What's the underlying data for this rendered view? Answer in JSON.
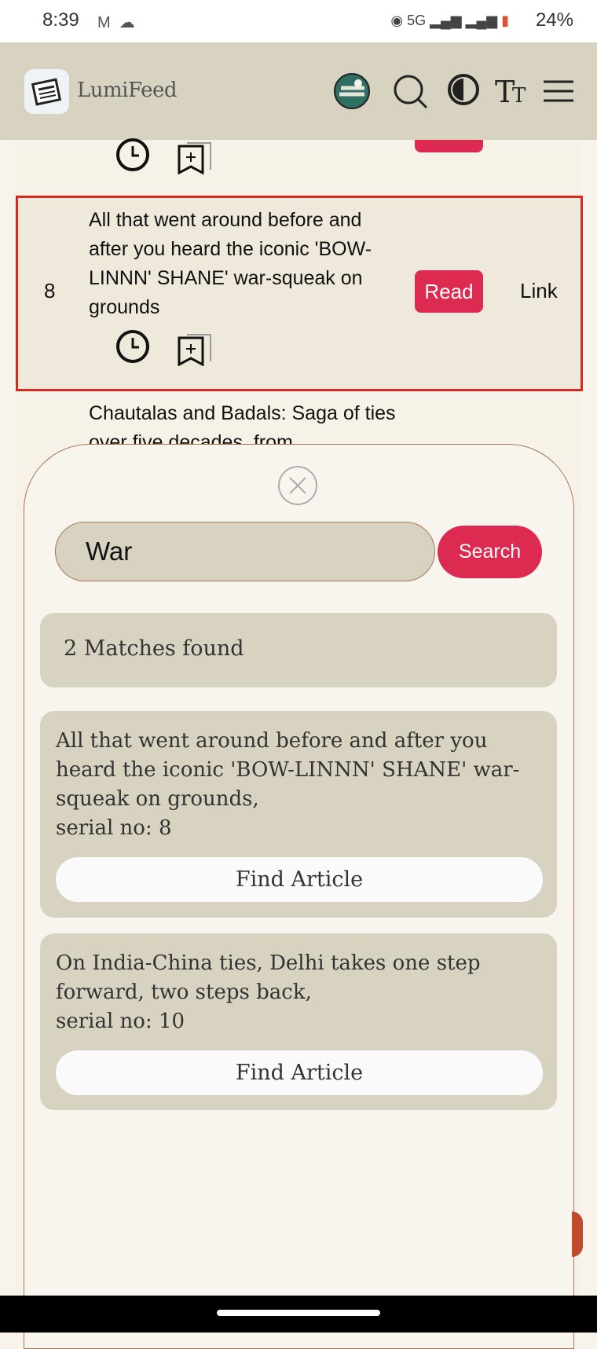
{
  "status_bar": {
    "time": "8:39",
    "network": "5G",
    "battery": "24%"
  },
  "app": {
    "name": "LumiFeed"
  },
  "list": {
    "highlighted_row": {
      "number": "8",
      "title": "All that went around before and after you heard the iconic 'BOW-LINNN' SHANE' war-squeak on grounds",
      "read_label": "Read",
      "link_label": "Link"
    },
    "next_row_title": "Chautalas and Badals: Saga of ties over five decades, from"
  },
  "search": {
    "query": "War",
    "button_label": "Search",
    "matches_text": "2 Matches found",
    "results": [
      {
        "title": "All that went around before and after you heard the iconic 'BOW-LINNN' SHANE' war-squeak on grounds,",
        "serial": "serial no: 8",
        "button": "Find Article"
      },
      {
        "title": "On India-China ties, Delhi takes one step forward, two steps back,",
        "serial": "serial no: 10",
        "button": "Find Article"
      }
    ]
  }
}
